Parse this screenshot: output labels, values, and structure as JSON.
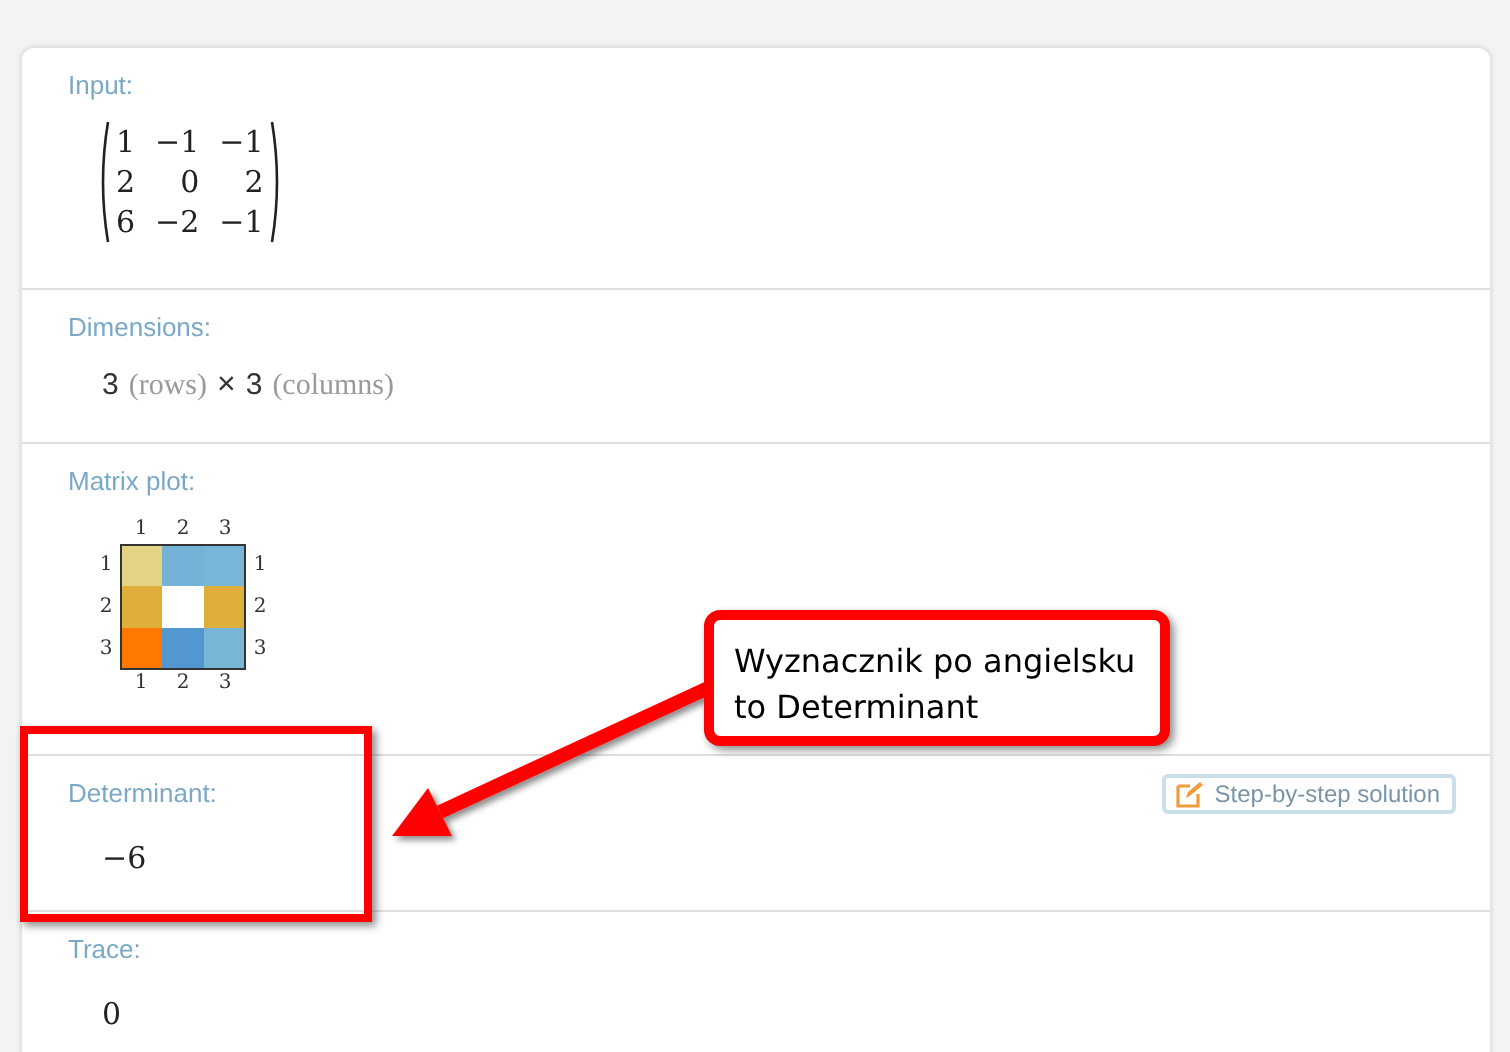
{
  "sections": [
    {
      "kind": "matrix",
      "label": "Input:",
      "rows": [
        [
          "1",
          "−1",
          "−1"
        ],
        [
          "2",
          "0",
          "2"
        ],
        [
          "6",
          "−2",
          "−1"
        ]
      ]
    },
    {
      "kind": "dimensions",
      "label": "Dimensions:",
      "parts": [
        {
          "kind": "value",
          "text": "3"
        },
        {
          "kind": "unit",
          "text": "(rows)"
        },
        {
          "kind": "operator",
          "text": "×"
        },
        {
          "kind": "value",
          "text": "3"
        },
        {
          "kind": "unit",
          "text": "(columns)"
        }
      ]
    },
    {
      "kind": "plot",
      "label": "Matrix plot:",
      "top_ticks": [
        "1",
        "2",
        "3"
      ],
      "bottom_ticks": [
        "1",
        "2",
        "3"
      ],
      "left_ticks": [
        "1",
        "2",
        "3"
      ],
      "right_ticks": [
        "1",
        "2",
        "3"
      ]
    },
    {
      "kind": "value",
      "label": "Determinant:",
      "value": "−6",
      "button": "Step-by-step solution"
    },
    {
      "kind": "value",
      "label": "Trace:",
      "value": "0"
    }
  ],
  "callout": {
    "text": "Wyznacznik po angielsku to Determinant"
  }
}
